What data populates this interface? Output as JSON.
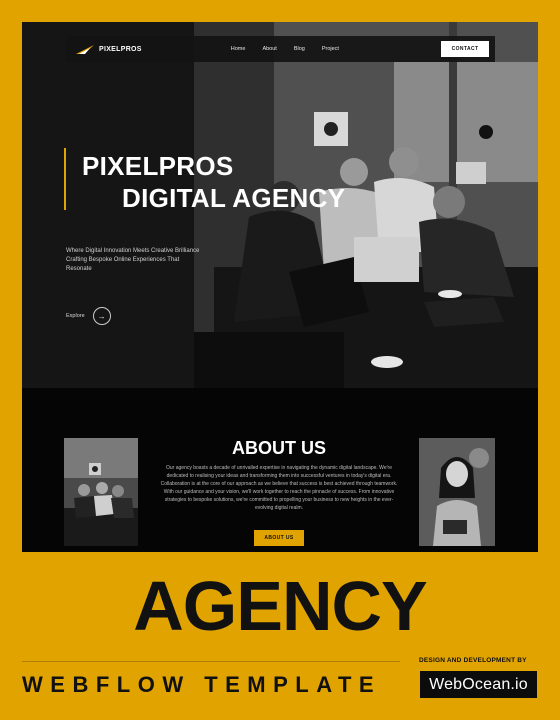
{
  "nav": {
    "logo_text": "PIXELPROS",
    "links": [
      "Home",
      "About",
      "Blog",
      "Project"
    ],
    "contact_label": "CONTACT"
  },
  "hero": {
    "headline_line1": "PIXELPROS",
    "headline_line2": "DIGITAL AGENCY",
    "tagline": "Where Digital Innovation Meets Creative Brilliance Crafting Bespoke Online Experiences That Resonate",
    "explore_label": "Explore",
    "explore_icon": "arrow-right-icon"
  },
  "about": {
    "title": "ABOUT US",
    "body": "Our agency boasts a decade of unrivalled expertise in navigating the dynamic digital landscape. We're dedicated to realising your ideas and transforming them into successful ventures in today's digital era. Collaboration is at the core of our approach as we believe that success is best achieved through teamwork. With our guidance and your vision, we'll work together to reach the pinnacle of success. From innovative strategies to bespoke solutions, we're committed to propelling your business to new heights in the ever-evolving digital realm.",
    "button_label": "ABOUT US"
  },
  "promo": {
    "title": "AGENCY",
    "subtitle": "WEBFLOW TEMPLATE",
    "design_credit": "DESIGN AND DEVELOPMENT BY",
    "brand": "WebOcean.io"
  },
  "colors": {
    "accent": "#e0a300",
    "background_dark": "#0b0b0b"
  }
}
